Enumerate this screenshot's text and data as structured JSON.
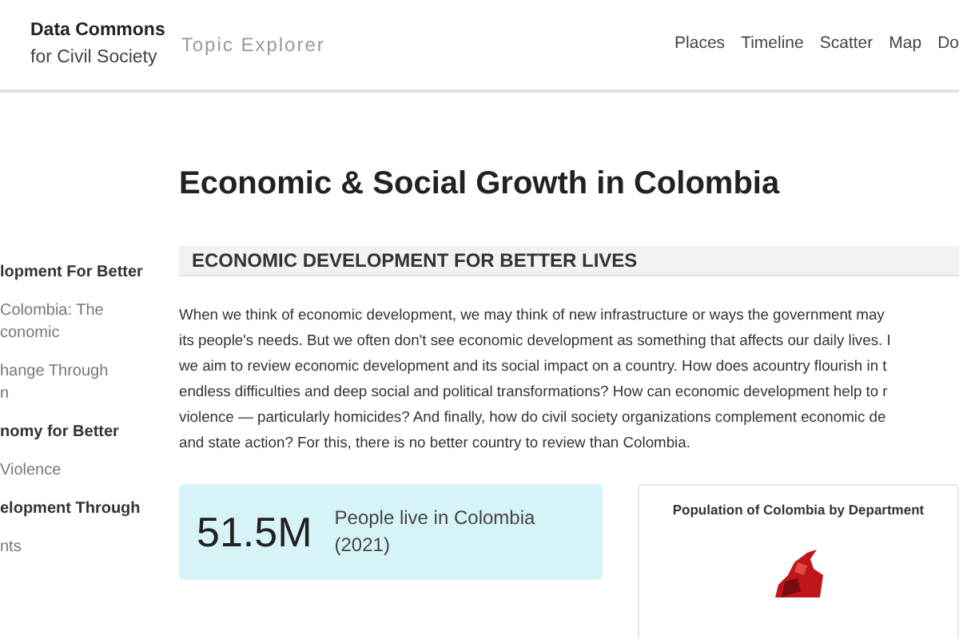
{
  "header": {
    "brand_line_1": "Data Commons",
    "brand_line_2": "for Civil Society",
    "subtitle": "Topic Explorer",
    "nav": [
      "Places",
      "Timeline",
      "Scatter",
      "Map",
      "Do"
    ]
  },
  "sidebar": {
    "items": [
      {
        "kind": "section",
        "lines": [
          "lopment For Better"
        ]
      },
      {
        "kind": "subsection",
        "lines": [
          "Colombia: The",
          "conomic"
        ]
      },
      {
        "kind": "subsection",
        "lines": [
          "hange Through",
          "n"
        ]
      },
      {
        "kind": "section",
        "lines": [
          "nomy for Better"
        ]
      },
      {
        "kind": "subsection",
        "lines": [
          "Violence"
        ]
      },
      {
        "kind": "section",
        "lines": [
          "elopment Through"
        ]
      },
      {
        "kind": "subsection",
        "lines": [
          "nts"
        ]
      }
    ]
  },
  "page_title": "Economic & Social Growth in Colombia",
  "section_heading": "ECONOMIC DEVELOPMENT FOR BETTER LIVES",
  "paragraph_lines": [
    "When we think of economic development, we may think of new infrastructure or ways the government may",
    "its people's needs. But we often don't see economic development as something that affects our daily lives. I",
    "we aim to review economic development and its social impact on a country. How does acountry flourish in t",
    "endless difficulties and deep social and political transformations? How can economic development help to r",
    "violence — particularly homicides? And finally, how do civil society organizations complement economic de",
    "and state action? For this, there is no better country to review than Colombia."
  ],
  "stat": {
    "value": "51.5M",
    "label_lines": [
      "People live in Colombia",
      "(2021)"
    ]
  },
  "map_card": {
    "title": "Population of Colombia by Department"
  }
}
